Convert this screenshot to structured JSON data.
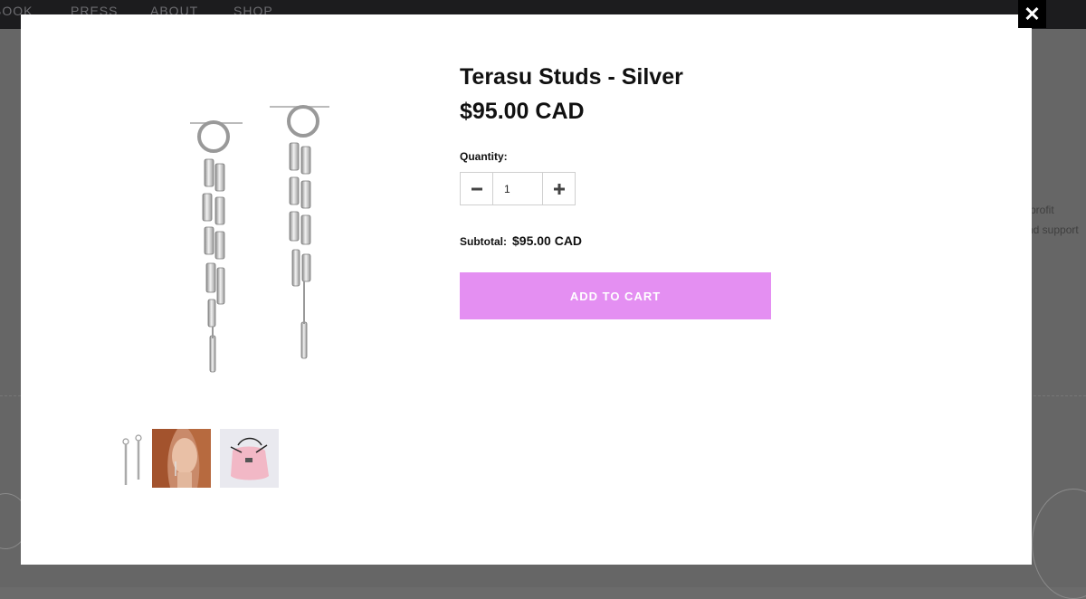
{
  "background": {
    "nav": [
      "BOOK",
      "PRESS",
      "ABOUT",
      "SHOP"
    ],
    "snippet_1": "profit",
    "snippet_2": "nd support"
  },
  "modal": {
    "close_glyph": "✕",
    "title": "Terasu Studs - Silver",
    "price": "$95.00 CAD",
    "quantity_label": "Quantity:",
    "quantity_value": "1",
    "subtotal_label": "Subtotal:",
    "subtotal_value": "$95.00 CAD",
    "add_to_cart": "ADD TO CART",
    "icons": {
      "minus": "minus-icon",
      "plus": "plus-icon",
      "close": "close-icon"
    },
    "colors": {
      "button": "#e48ff2",
      "close_bg": "#000000"
    }
  }
}
